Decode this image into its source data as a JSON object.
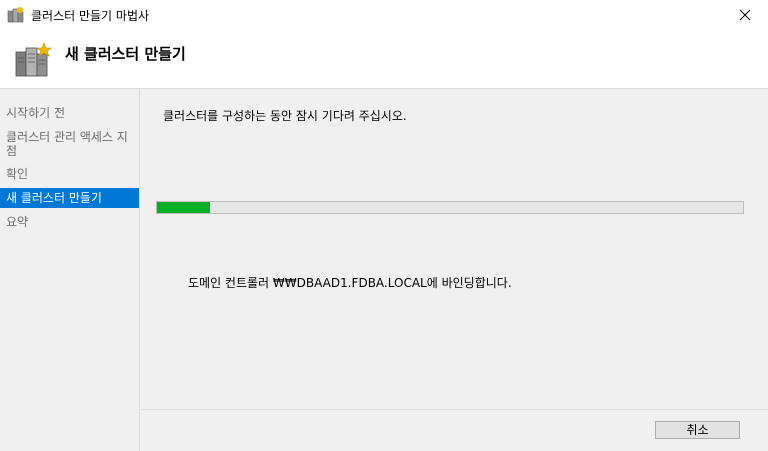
{
  "window": {
    "title": "클러스터 만들기 마법사",
    "close_icon": "close-icon",
    "app_icon": "cluster-wizard-icon"
  },
  "header": {
    "title": "새 클러스터 만들기",
    "icon": "cluster-servers-icon"
  },
  "sidebar": {
    "items": [
      {
        "label": "시작하기 전",
        "active": false
      },
      {
        "label": "클러스터 관리 액세스 지점",
        "active": false
      },
      {
        "label": "확인",
        "active": false
      },
      {
        "label": "새 클러스터 만들기",
        "active": true
      },
      {
        "label": "요약",
        "active": false
      }
    ]
  },
  "main": {
    "wait_message": "클러스터를 구성하는 동안 잠시 기다려 주십시오.",
    "progress_percent": 9,
    "status_message": "도메인 컨트롤러 ₩₩DBAAD1.FDBA.LOCAL에 바인딩합니다."
  },
  "footer": {
    "cancel_label": "취소"
  },
  "colors": {
    "accent": "#0078d7",
    "progress": "#06b025",
    "background": "#f0f0f0"
  }
}
